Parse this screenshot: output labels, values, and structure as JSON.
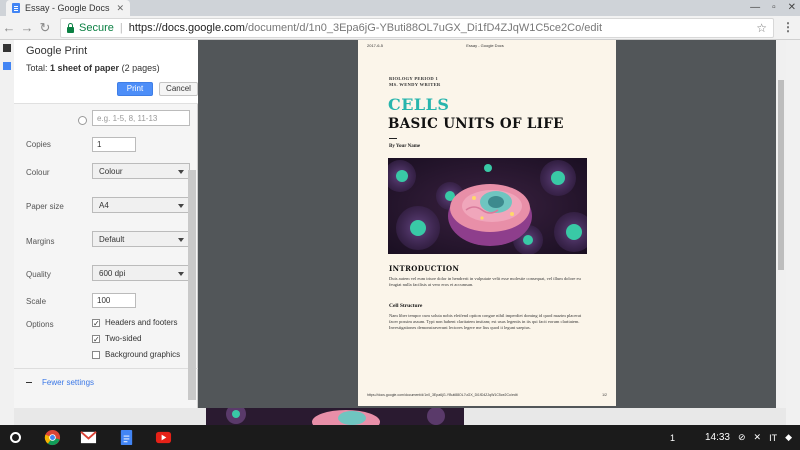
{
  "browser": {
    "tab_title": "Essay - Google Docs",
    "secure_label": "Secure",
    "url_host": "https://docs.google.com",
    "url_path": "/document/d/1n0_3Epa6jG-YButi88OL7uGX_Di1fD4ZJqW1C5ce2Co/edit"
  },
  "print_dialog": {
    "title": "Google Print",
    "total_label": "Total:",
    "total_value": "1 sheet of paper",
    "total_pages": "(2 pages)",
    "print_button": "Print",
    "cancel_button": "Cancel",
    "pages_placeholder": "e.g. 1-5, 8, 11-13",
    "copies_label": "Copies",
    "copies_value": "1",
    "colour_label": "Colour",
    "colour_value": "Colour",
    "paper_size_label": "Paper size",
    "paper_size_value": "A4",
    "margins_label": "Margins",
    "margins_value": "Default",
    "quality_label": "Quality",
    "quality_value": "600 dpi",
    "scale_label": "Scale",
    "scale_value": "100",
    "options_label": "Options",
    "option_headers": "Headers and footers",
    "option_headers_checked": true,
    "option_two_sided": "Two-sided",
    "option_two_sided_checked": true,
    "option_background": "Background graphics",
    "option_background_checked": false,
    "fewer_settings": "Fewer settings"
  },
  "document": {
    "header_date": "2017-6-5",
    "header_title": "Essay - Google Docs",
    "course_line1": "BIOLOGY PERIOD 1",
    "course_line2": "MS. WENDY WRITER",
    "title_accent": "CELLS",
    "title_main": "BASIC UNITS OF LIFE",
    "byline": "By Your Name",
    "section_heading": "INTRODUCTION",
    "intro_text": "Duis autem vel eum iriure dolor in hendrerit in vulputate velit esse molestie consequat, vel illum dolore eu feugiat nulla facilisis at vero eros et accumsan.",
    "subsection_heading": "Cell Structure",
    "structure_text": "Nam liber tempor cum soluta nobis eleifend option congue nihil imperdiet doming id quod mazim placerat facer possim assum. Typi non habent claritatem insitam; est usus legentis in iis qui facit eorum claritatem. Investigationes demonstraverunt lectores legere me lius quod ii legunt saepius.",
    "footer_url": "https://docs.google.com/document/d/1n0_3Epa6jG-YButi88OL7uGX_Di1fD4ZJqW1C5ce2Co/edit",
    "footer_page": "1/2"
  },
  "shelf": {
    "page_indicator": "1",
    "clock": "14:33",
    "locale": "IT"
  },
  "colors": {
    "accent_teal": "#27b5ad",
    "print_blue": "#4d8ef8",
    "preview_bg": "#525659",
    "paper": "#fbf5ea"
  }
}
